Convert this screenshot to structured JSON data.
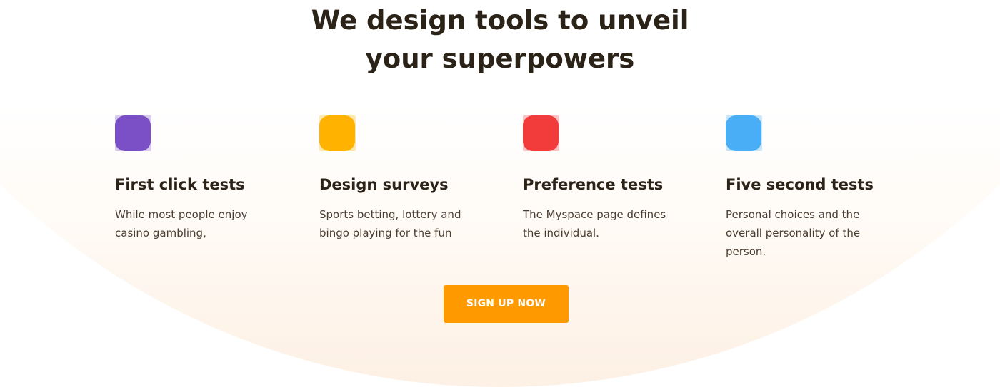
{
  "headline": {
    "line1": "We design tools to unveil",
    "line2": "your superpowers"
  },
  "features": [
    {
      "icon": "purple-square-icon",
      "color": "#7b4fc6",
      "title": "First click tests",
      "description": "While most people enjoy casino gambling,"
    },
    {
      "icon": "yellow-square-icon",
      "color": "#ffb300",
      "title": "Design surveys",
      "description": "Sports betting, lottery and bingo playing for the fun"
    },
    {
      "icon": "red-square-icon",
      "color": "#f23b3b",
      "title": "Preference tests",
      "description": "The Myspace page defines the individual."
    },
    {
      "icon": "blue-square-icon",
      "color": "#4aaef7",
      "title": "Five second tests",
      "description": "Personal choices and the overall personality of the person."
    }
  ],
  "cta": {
    "label": "SIGN UP NOW",
    "color": "#ff9900"
  }
}
